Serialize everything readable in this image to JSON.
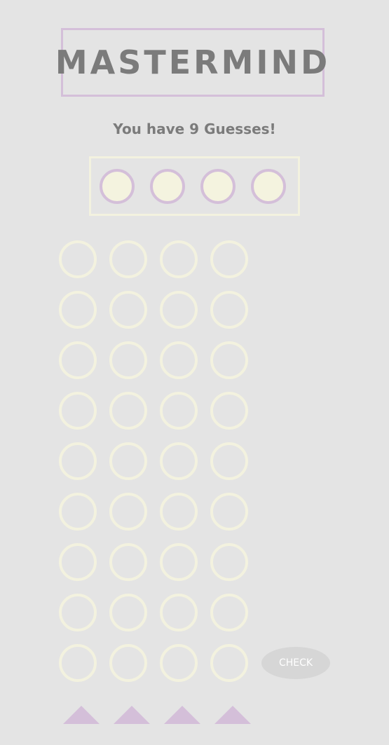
{
  "title": "MASTERMIND",
  "status_text": "You have 9 Guesses!",
  "colors": {
    "background": "#e4e4e4",
    "accent": "#d4bfd9",
    "peg_empty": "#f3f2df",
    "text": "#7b7b7b",
    "button": "#d6d6d6"
  },
  "secret_code": [
    "hidden",
    "hidden",
    "hidden",
    "hidden"
  ],
  "board": {
    "rows": 9,
    "columns": 4
  },
  "check_button": {
    "label": "CHECK"
  },
  "color_selectors": [
    "triangle-up-icon",
    "triangle-up-icon",
    "triangle-up-icon",
    "triangle-up-icon"
  ]
}
